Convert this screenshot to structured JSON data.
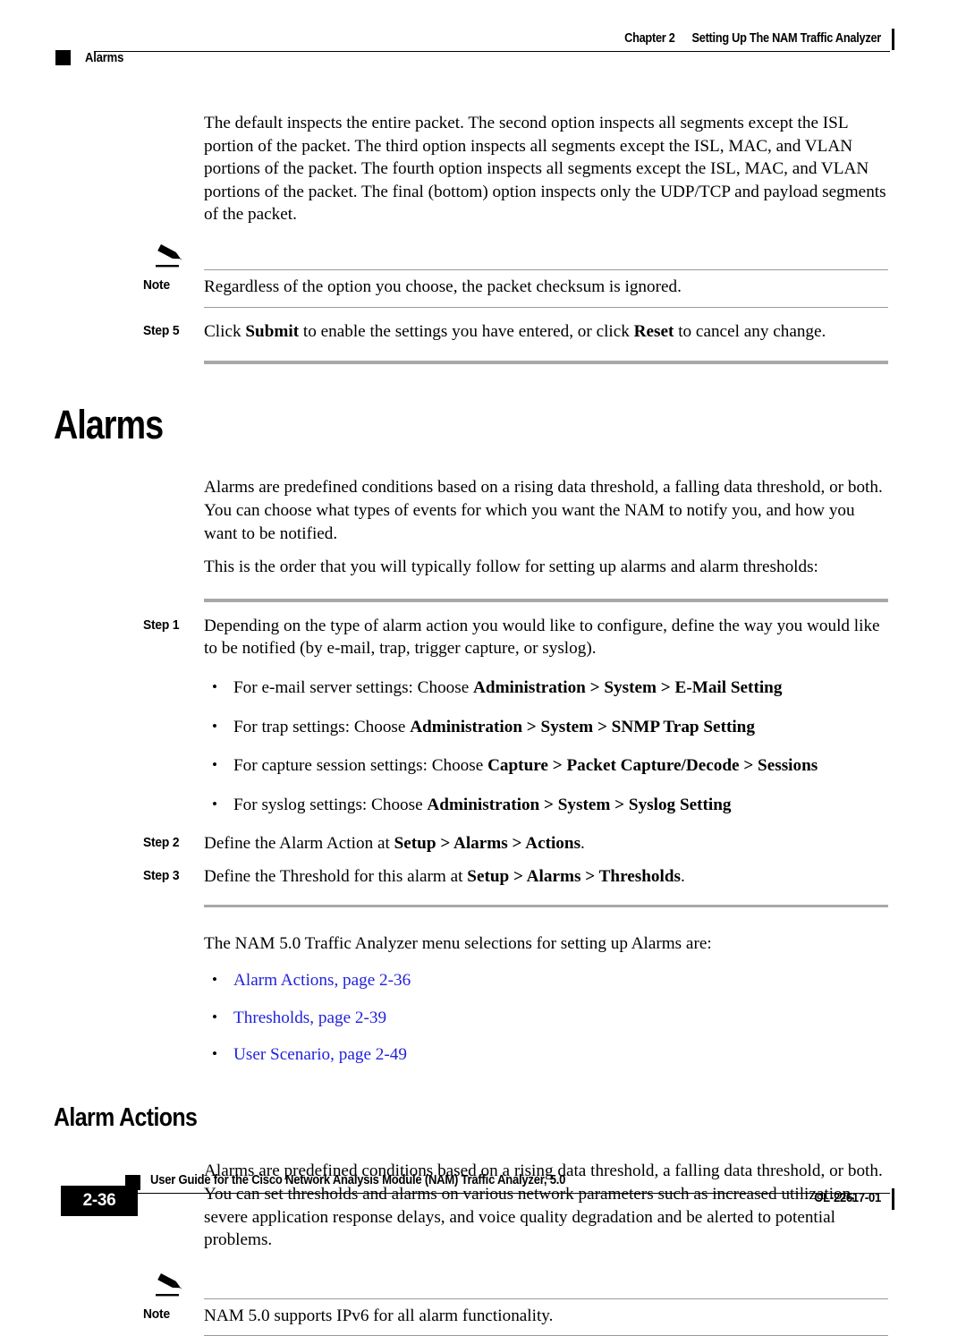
{
  "header": {
    "chapter": "Chapter 2",
    "chapter_title": "Setting Up The NAM Traffic Analyzer",
    "running_head": "Alarms"
  },
  "intro": {
    "paragraph": "The default inspects the entire packet. The second option inspects all segments except the ISL portion of the packet. The third option inspects all segments except the ISL, MAC, and VLAN portions of the packet. The fourth option inspects all segments except the ISL, MAC, and VLAN portions of the packet. The final (bottom) option inspects only the UDP/TCP and payload segments of the packet."
  },
  "note_1": {
    "label": "Note",
    "text": "Regardless of the option you choose, the packet checksum is ignored.",
    "icon": "pencil-icon"
  },
  "step_5": {
    "label": "Step 5",
    "text_part1": "Click ",
    "bold1": "Submit",
    "text_part2": " to enable the settings you have entered, or click ",
    "bold2": "Reset",
    "text_part3": " to cancel any change."
  },
  "alarms_section": {
    "heading": "Alarms",
    "paragraph_1": "Alarms are predefined conditions based on a rising data threshold, a falling data threshold, or both. You can choose what types of events for which you want the NAM to notify you, and how you want to be notified.",
    "paragraph_2": "This is the order that you will typically follow for setting up alarms and alarm thresholds:"
  },
  "procedure": {
    "step_1": {
      "label": "Step 1",
      "text": "Depending on the type of alarm action you would like to configure, define the way you would like to be notified (by e-mail, trap, trigger capture, or syslog)."
    },
    "bullets": [
      {
        "lead": "For e-mail server settings: Choose ",
        "path": "Administration > System > E-Mail Setting"
      },
      {
        "lead": "For trap settings: Choose ",
        "path": "Administration > System > SNMP Trap Setting"
      },
      {
        "lead": "For capture session settings: Choose ",
        "path": "Capture > Packet Capture/Decode > Sessions"
      },
      {
        "lead": "For syslog settings: Choose ",
        "path": "Administration > System > Syslog Setting"
      }
    ],
    "step_2": {
      "label": "Step 2",
      "lead": "Define the Alarm Action at ",
      "path": "Setup > Alarms > Actions",
      "trail": "."
    },
    "step_3": {
      "label": "Step 3",
      "lead": "Define the Threshold for this alarm at ",
      "path": "Setup > Alarms > Thresholds",
      "trail": "."
    }
  },
  "menu_selections": {
    "paragraph": "The NAM 5.0 Traffic Analyzer menu selections for setting up Alarms are:",
    "links": [
      "Alarm Actions, page 2-36",
      "Thresholds, page 2-39",
      "User Scenario, page 2-49"
    ],
    "link_color": "#2222dd"
  },
  "alarm_actions_section": {
    "heading": "Alarm Actions",
    "paragraph": "Alarms are predefined conditions based on a rising data threshold, a falling data threshold, or both. You can set thresholds and alarms on various network parameters such as increased utilization, severe application response delays, and voice quality degradation and be alerted to potential problems."
  },
  "note_2": {
    "label": "Note",
    "text": "NAM 5.0 supports IPv6 for all alarm functionality.",
    "icon": "pencil-icon"
  },
  "footer": {
    "page_number": "2-36",
    "guide_title": "User Guide for the Cisco Network Analysis Module (NAM) Traffic Analyzer, 5.0",
    "doc_id": "OL-22617-01"
  }
}
